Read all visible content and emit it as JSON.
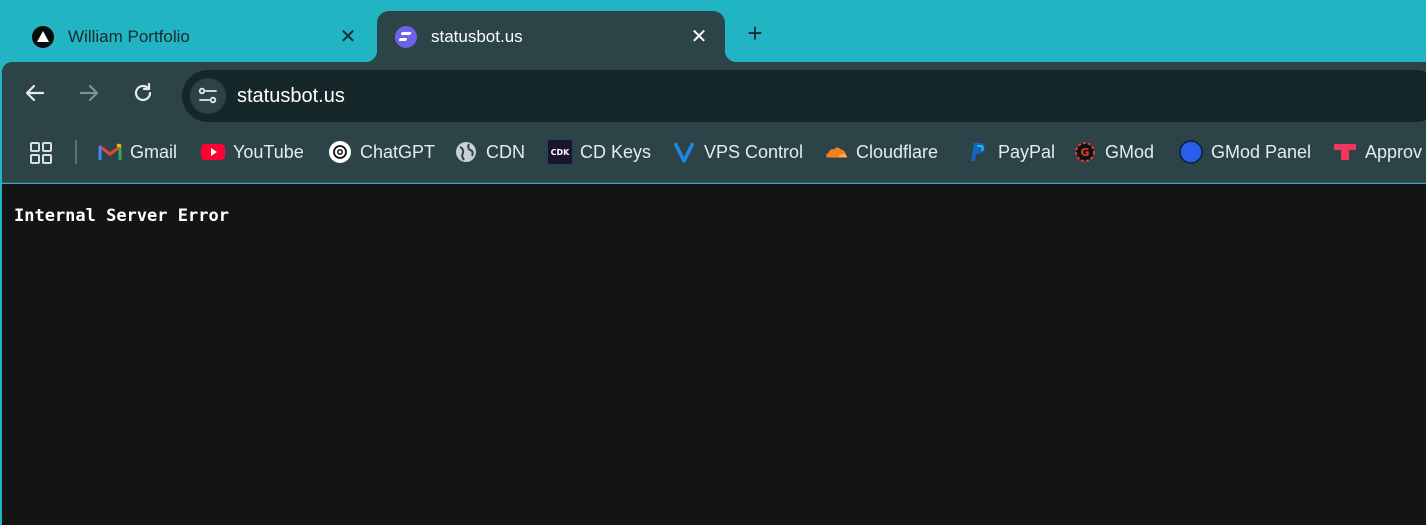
{
  "tabs": [
    {
      "title": "William Portfolio",
      "close": "✕",
      "favicon": "triangle-logo-icon",
      "active": false
    },
    {
      "title": "statusbot.us",
      "close": "✕",
      "favicon": "statusbot-logo-icon",
      "active": true
    }
  ],
  "new_tab_label": "+",
  "omnibox": {
    "url": "statusbot.us"
  },
  "bookmarks": [
    {
      "label": "Gmail",
      "icon": "gmail-icon"
    },
    {
      "label": "YouTube",
      "icon": "youtube-icon"
    },
    {
      "label": "ChatGPT",
      "icon": "chatgpt-icon"
    },
    {
      "label": "CDN",
      "icon": "globe-icon"
    },
    {
      "label": "CD Keys",
      "icon": "cdk-icon",
      "icon_text": "CDK"
    },
    {
      "label": "VPS Control",
      "icon": "vps-icon"
    },
    {
      "label": "Cloudflare",
      "icon": "cloudflare-icon"
    },
    {
      "label": "PayPal",
      "icon": "paypal-icon"
    },
    {
      "label": "GMod",
      "icon": "gmod-icon"
    },
    {
      "label": "GMod Panel",
      "icon": "blue-circle-icon"
    },
    {
      "label": "Approv",
      "icon": "approv-icon"
    }
  ],
  "page": {
    "message": "Internal Server Error"
  },
  "colors": {
    "tabstrip": "#21b5c4",
    "toolbar": "#2c4347",
    "omnibox": "#162729",
    "page_bg": "#141414"
  }
}
